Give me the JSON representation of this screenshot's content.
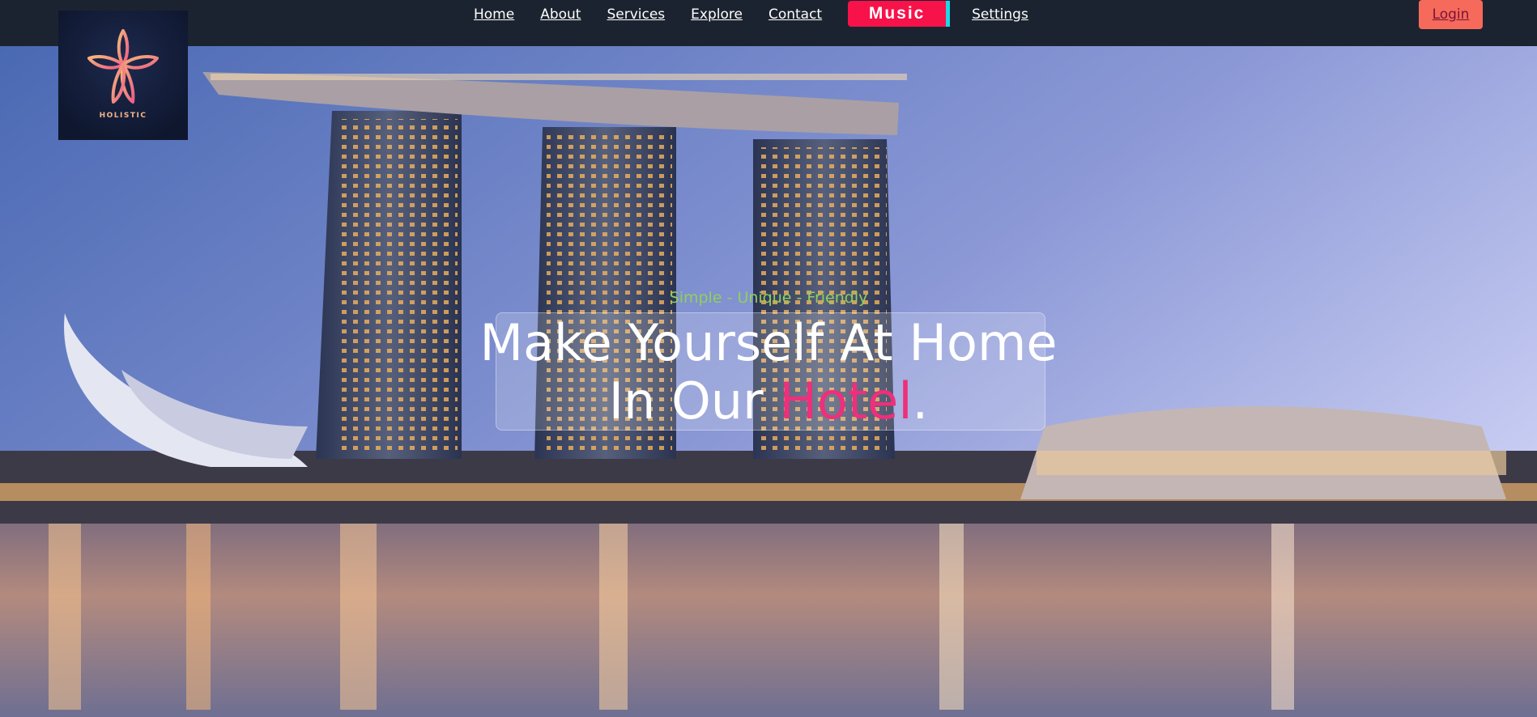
{
  "nav": {
    "items": [
      "Home",
      "About",
      "Services",
      "Explore",
      "Contact"
    ],
    "music_label": "Music",
    "settings_label": "Settings",
    "login_label": "Login"
  },
  "logo": {
    "text": "HOLISTIC"
  },
  "hero": {
    "tagline": "Simple - Unique - Friendly",
    "headline_line1": "Make Yourself At Home",
    "headline_line2_prefix": "In Our ",
    "headline_accent": "Hotel",
    "headline_suffix": "."
  },
  "colors": {
    "nav_bg": "#1c2330",
    "music_bg": "#f7124a",
    "music_stripe": "#1fd6e6",
    "login_bg": "#f56a5b",
    "tagline": "#8fd05a",
    "accent": "#ee2f7b"
  }
}
